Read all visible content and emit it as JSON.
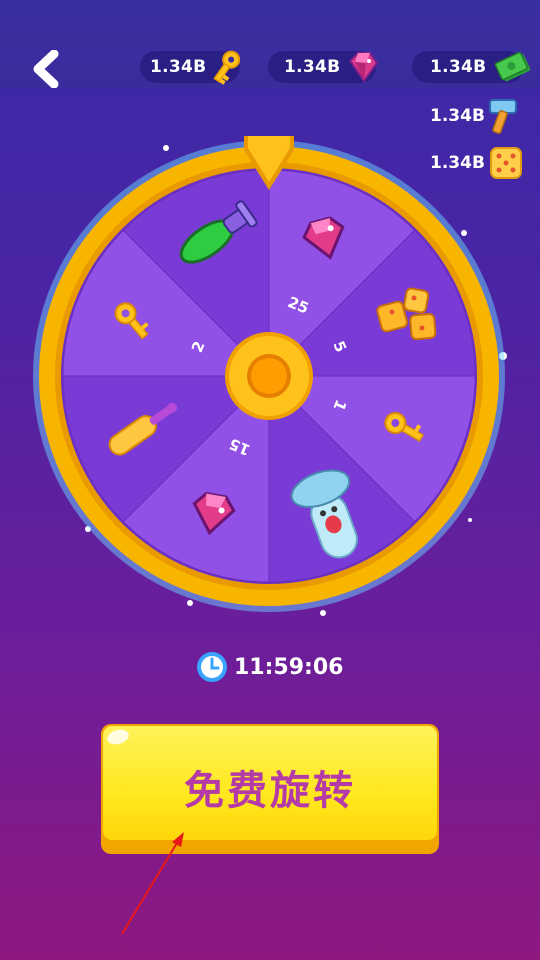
{
  "header": {
    "currencies": [
      {
        "value": "1.34B",
        "icon": "key-icon"
      },
      {
        "value": "1.34B",
        "icon": "gem-icon"
      },
      {
        "value": "1.34B",
        "icon": "cash-icon"
      }
    ],
    "side_currencies": [
      {
        "value": "1.34B",
        "icon": "hammer-icon"
      },
      {
        "value": "1.34B",
        "icon": "dice-icon"
      }
    ]
  },
  "wheel": {
    "segments": [
      {
        "reward": "gem",
        "amount": "25"
      },
      {
        "reward": "dice",
        "amount": "5"
      },
      {
        "reward": "key",
        "amount": "1"
      },
      {
        "reward": "character",
        "amount": ""
      },
      {
        "reward": "gem",
        "amount": "15"
      },
      {
        "reward": "roller",
        "amount": ""
      },
      {
        "reward": "key",
        "amount": "2"
      },
      {
        "reward": "rocket",
        "amount": ""
      }
    ],
    "colors": {
      "rim": "#f7b500",
      "slice_dark": "#7a3ad6",
      "slice_light": "#9150e6",
      "hub": "#ffb400"
    }
  },
  "timer": {
    "value": "11:59:06",
    "icon": "clock-icon"
  },
  "spin_button": {
    "label": "免费旋转"
  }
}
